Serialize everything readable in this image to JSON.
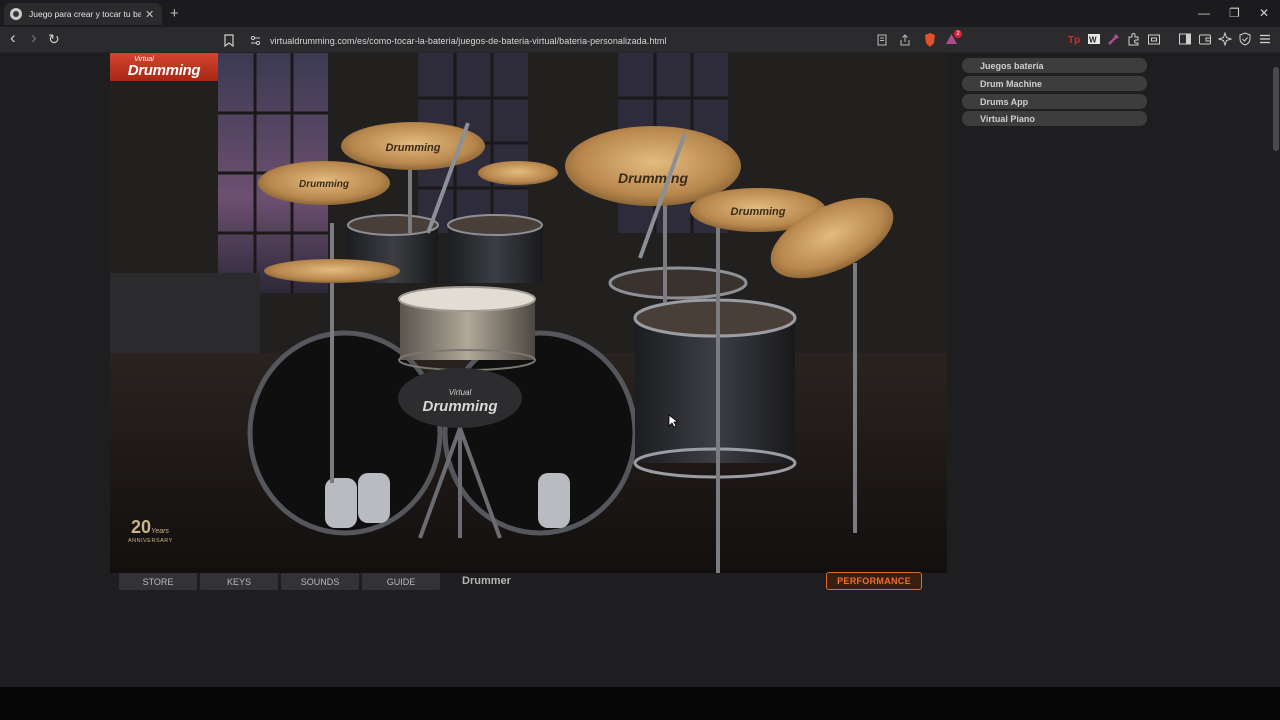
{
  "browser": {
    "tab_title": "Juego para crear y tocar tu bate",
    "tab_close": "✕",
    "new_tab": "+",
    "url": "virtualdrumming.com/es/como-tocar-la-bateria/juegos-de-bateria-virtual/bateria-personalizada.html",
    "window_controls": {
      "minimize": "—",
      "restore": "❐",
      "close": "✕"
    },
    "nav": {
      "back": "‹",
      "forward": "›",
      "reload": "↻"
    },
    "extension_badges": {
      "brave_rewards": "2"
    }
  },
  "stage": {
    "logo_small": "Virtual",
    "logo_big": "Drumming",
    "cymbal_brand": "Drumming",
    "stool_brand_small": "Virtual",
    "stool_brand_big": "Drumming",
    "anniversary_number": "20",
    "anniversary_word": "Years",
    "anniversary_label": "ANNIVERSARY"
  },
  "drum_tabs": [
    {
      "label": "STORE"
    },
    {
      "label": "KEYS"
    },
    {
      "label": "SOUNDS"
    },
    {
      "label": "GUIDE"
    }
  ],
  "drummer_label": "Drummer",
  "performance_button": "PERFORMANCE",
  "side_links": [
    {
      "label": "Juegos batería"
    },
    {
      "label": "Drum Machine"
    },
    {
      "label": "Drums App"
    },
    {
      "label": "Virtual Piano"
    }
  ],
  "colors": {
    "accent_orange": "#e06a2b",
    "logo_red": "#c23a23",
    "cymbal_bronze": "#c89a5e"
  }
}
